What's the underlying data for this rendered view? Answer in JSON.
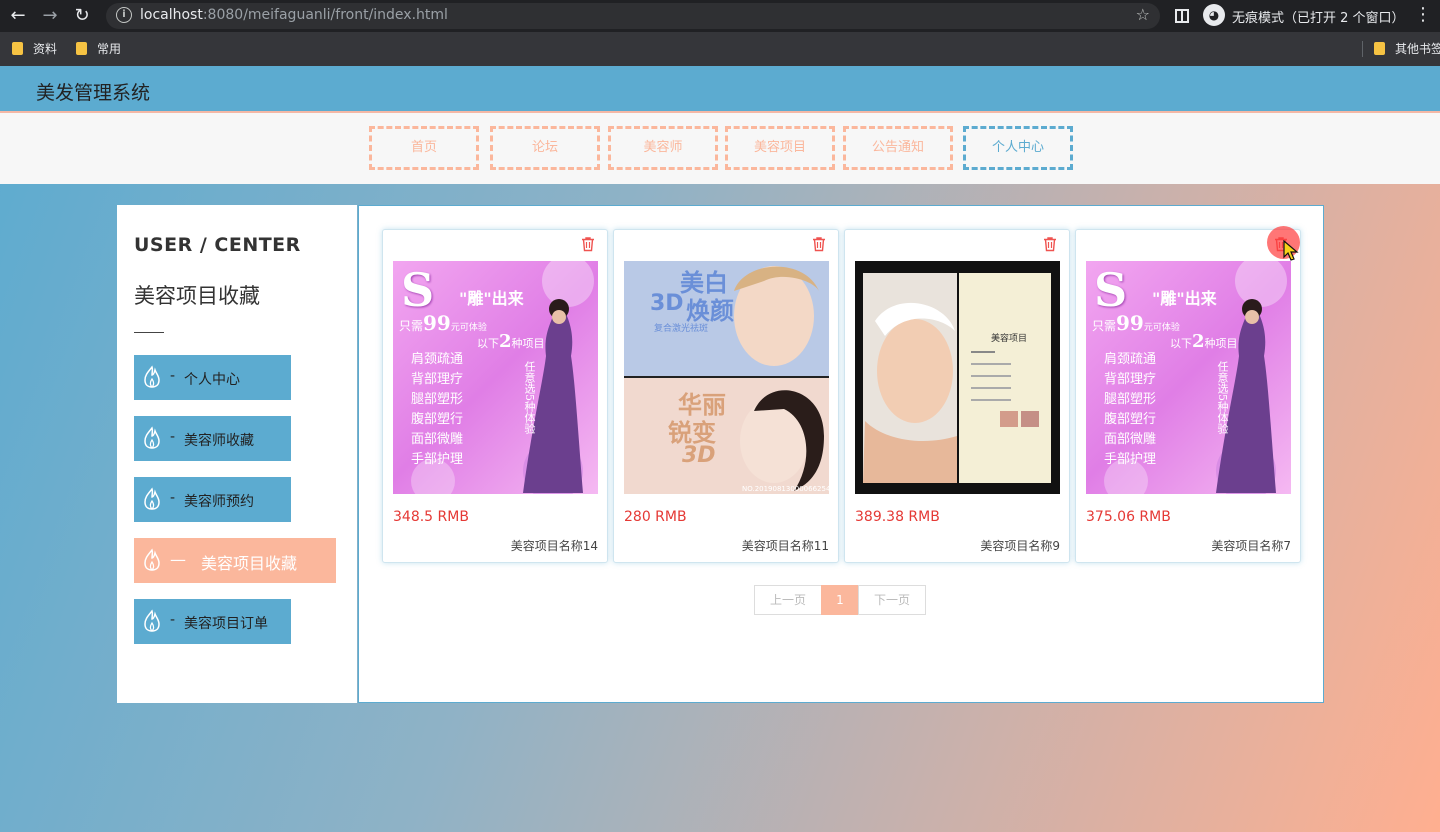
{
  "browser": {
    "url_host": "localhost",
    "url_rest": ":8080/meifaguanli/front/index.html",
    "incognito_label": "无痕模式（已打开 2 个窗口）",
    "bookmarks": [
      "资料",
      "常用"
    ],
    "other_bookmarks": "其他书签"
  },
  "site": {
    "title": "美发管理系统"
  },
  "nav": [
    "首页",
    "论坛",
    "美容师",
    "美容项目",
    "公告通知",
    "个人中心"
  ],
  "sidebar": {
    "heading": "USER / CENTER",
    "section_title": "美容项目收藏",
    "items": [
      {
        "dash": "-",
        "label": "个人中心"
      },
      {
        "dash": "-",
        "label": "美容师收藏"
      },
      {
        "dash": "-",
        "label": "美容师预约"
      },
      {
        "dash": "—",
        "label": "美容项目收藏"
      },
      {
        "dash": "-",
        "label": "美容项目订单"
      }
    ]
  },
  "cards": [
    {
      "price": "348.5 RMB",
      "name": "美容项目名称14"
    },
    {
      "price": "280 RMB",
      "name": "美容项目名称11"
    },
    {
      "price": "389.38 RMB",
      "name": "美容项目名称9"
    },
    {
      "price": "375.06 RMB",
      "name": "美容项目名称7"
    }
  ],
  "posters": {
    "a": {
      "logo": "S",
      "headline": "\"雕\"出来",
      "offer": "只需",
      "offer_price": "99",
      "offer_unit": "元可体验",
      "below": "以下",
      "count": "2",
      "count_unit": "种项目",
      "list": [
        "肩颈疏通",
        "背部理疗",
        "腿部塑形",
        "腹部塑行",
        "面部微雕",
        "手部护理"
      ],
      "side_text": "任意选5种体验"
    },
    "b": {
      "top_title": "美白",
      "top_badge": "3D",
      "top_title2": "焕颜",
      "top_sub": "复合激光祛斑",
      "bottom_title": "华丽",
      "bottom_title2": "锐变",
      "bottom_3d": "3D",
      "footer": "NO.20190813000066254"
    },
    "c": {
      "menu_title": "美容项目"
    }
  },
  "pager": {
    "prev": "上一页",
    "current": "1",
    "next": "下一页"
  },
  "colors": {
    "primary": "#5cabd0",
    "accent": "#fbb79c",
    "price": "#e53935"
  }
}
